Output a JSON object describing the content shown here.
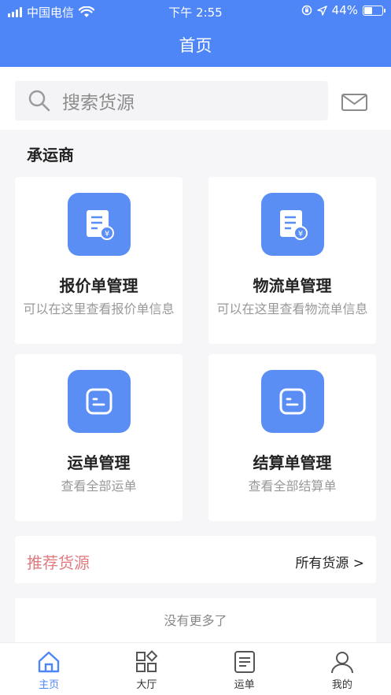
{
  "status": {
    "carrier": "中国电信",
    "time": "下午 2:55",
    "battery": "44%"
  },
  "header": {
    "title": "首页"
  },
  "search": {
    "placeholder": "搜索货源"
  },
  "section": {
    "title": "承运商"
  },
  "cards": [
    {
      "title": "报价单管理",
      "subtitle": "可以在这里查看报价单信息"
    },
    {
      "title": "物流单管理",
      "subtitle": "可以在这里查看物流单信息"
    },
    {
      "title": "运单管理",
      "subtitle": "查看全部运单"
    },
    {
      "title": "结算单管理",
      "subtitle": "查看全部结算单"
    }
  ],
  "recommend": {
    "title": "推荐货源",
    "link": "所有货源 >"
  },
  "more_text": "没有更多了",
  "tabs": [
    {
      "label": "主页",
      "icon": "home-icon",
      "active": true
    },
    {
      "label": "大厅",
      "icon": "grid-icon",
      "active": false
    },
    {
      "label": "运单",
      "icon": "document-icon",
      "active": false
    },
    {
      "label": "我的",
      "icon": "user-icon",
      "active": false
    }
  ],
  "colors": {
    "primary": "#4f86f7",
    "icon_bg": "#5b8ef4",
    "recommend": "#e07b82"
  }
}
